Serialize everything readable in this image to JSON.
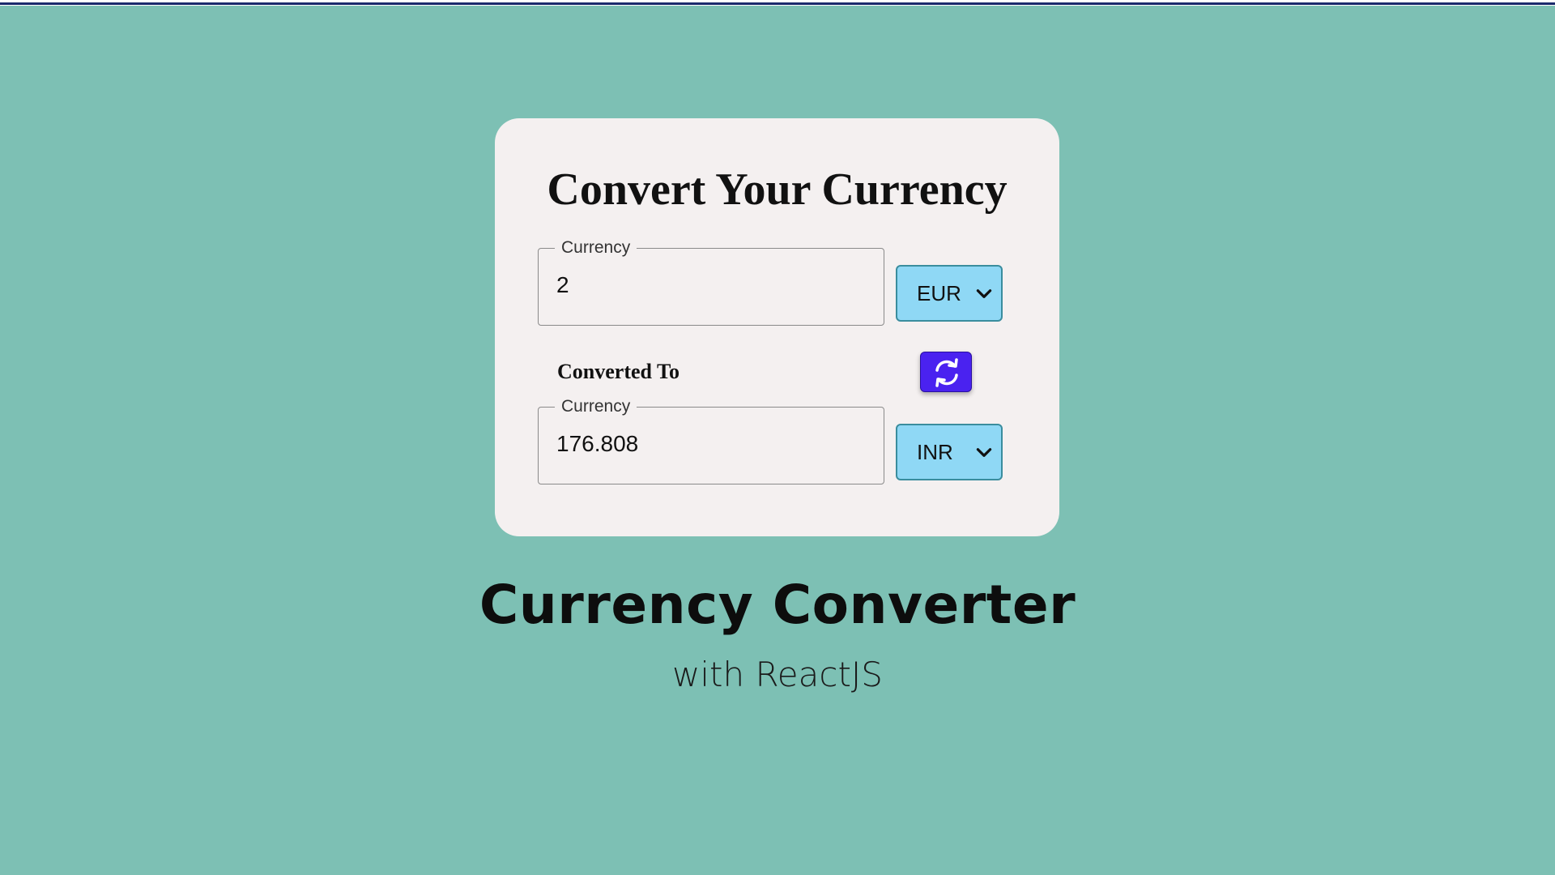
{
  "colors": {
    "background": "#7dc0b4",
    "card": "#f4f0f0",
    "select_bg": "#8fd8f5",
    "swap_button": "#4a22f0"
  },
  "card": {
    "title": "Convert Your Currency",
    "from": {
      "legend": "Currency",
      "value": "2",
      "currency": "EUR"
    },
    "converted_label": "Converted To",
    "swap_icon": "swap-arrows-icon",
    "to": {
      "legend": "Currency",
      "value": "176.808",
      "currency": "INR"
    }
  },
  "footer": {
    "title": "Currency Converter",
    "subtitle": "with ReactJS"
  }
}
